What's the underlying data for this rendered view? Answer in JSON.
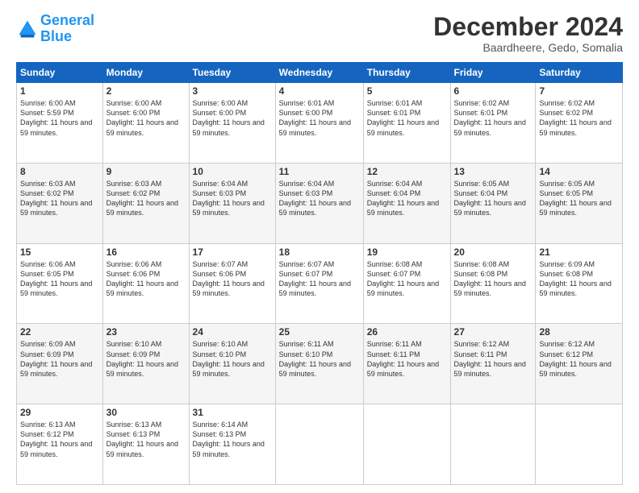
{
  "header": {
    "logo_line1": "General",
    "logo_line2": "Blue",
    "month": "December 2024",
    "location": "Baardheere, Gedo, Somalia"
  },
  "weekdays": [
    "Sunday",
    "Monday",
    "Tuesday",
    "Wednesday",
    "Thursday",
    "Friday",
    "Saturday"
  ],
  "weeks": [
    [
      {
        "day": "1",
        "sunrise": "6:00 AM",
        "sunset": "5:59 PM",
        "daylight": "11 hours and 59 minutes"
      },
      {
        "day": "2",
        "sunrise": "6:00 AM",
        "sunset": "6:00 PM",
        "daylight": "11 hours and 59 minutes"
      },
      {
        "day": "3",
        "sunrise": "6:00 AM",
        "sunset": "6:00 PM",
        "daylight": "11 hours and 59 minutes"
      },
      {
        "day": "4",
        "sunrise": "6:01 AM",
        "sunset": "6:00 PM",
        "daylight": "11 hours and 59 minutes"
      },
      {
        "day": "5",
        "sunrise": "6:01 AM",
        "sunset": "6:01 PM",
        "daylight": "11 hours and 59 minutes"
      },
      {
        "day": "6",
        "sunrise": "6:02 AM",
        "sunset": "6:01 PM",
        "daylight": "11 hours and 59 minutes"
      },
      {
        "day": "7",
        "sunrise": "6:02 AM",
        "sunset": "6:02 PM",
        "daylight": "11 hours and 59 minutes"
      }
    ],
    [
      {
        "day": "8",
        "sunrise": "6:03 AM",
        "sunset": "6:02 PM",
        "daylight": "11 hours and 59 minutes"
      },
      {
        "day": "9",
        "sunrise": "6:03 AM",
        "sunset": "6:02 PM",
        "daylight": "11 hours and 59 minutes"
      },
      {
        "day": "10",
        "sunrise": "6:04 AM",
        "sunset": "6:03 PM",
        "daylight": "11 hours and 59 minutes"
      },
      {
        "day": "11",
        "sunrise": "6:04 AM",
        "sunset": "6:03 PM",
        "daylight": "11 hours and 59 minutes"
      },
      {
        "day": "12",
        "sunrise": "6:04 AM",
        "sunset": "6:04 PM",
        "daylight": "11 hours and 59 minutes"
      },
      {
        "day": "13",
        "sunrise": "6:05 AM",
        "sunset": "6:04 PM",
        "daylight": "11 hours and 59 minutes"
      },
      {
        "day": "14",
        "sunrise": "6:05 AM",
        "sunset": "6:05 PM",
        "daylight": "11 hours and 59 minutes"
      }
    ],
    [
      {
        "day": "15",
        "sunrise": "6:06 AM",
        "sunset": "6:05 PM",
        "daylight": "11 hours and 59 minutes"
      },
      {
        "day": "16",
        "sunrise": "6:06 AM",
        "sunset": "6:06 PM",
        "daylight": "11 hours and 59 minutes"
      },
      {
        "day": "17",
        "sunrise": "6:07 AM",
        "sunset": "6:06 PM",
        "daylight": "11 hours and 59 minutes"
      },
      {
        "day": "18",
        "sunrise": "6:07 AM",
        "sunset": "6:07 PM",
        "daylight": "11 hours and 59 minutes"
      },
      {
        "day": "19",
        "sunrise": "6:08 AM",
        "sunset": "6:07 PM",
        "daylight": "11 hours and 59 minutes"
      },
      {
        "day": "20",
        "sunrise": "6:08 AM",
        "sunset": "6:08 PM",
        "daylight": "11 hours and 59 minutes"
      },
      {
        "day": "21",
        "sunrise": "6:09 AM",
        "sunset": "6:08 PM",
        "daylight": "11 hours and 59 minutes"
      }
    ],
    [
      {
        "day": "22",
        "sunrise": "6:09 AM",
        "sunset": "6:09 PM",
        "daylight": "11 hours and 59 minutes"
      },
      {
        "day": "23",
        "sunrise": "6:10 AM",
        "sunset": "6:09 PM",
        "daylight": "11 hours and 59 minutes"
      },
      {
        "day": "24",
        "sunrise": "6:10 AM",
        "sunset": "6:10 PM",
        "daylight": "11 hours and 59 minutes"
      },
      {
        "day": "25",
        "sunrise": "6:11 AM",
        "sunset": "6:10 PM",
        "daylight": "11 hours and 59 minutes"
      },
      {
        "day": "26",
        "sunrise": "6:11 AM",
        "sunset": "6:11 PM",
        "daylight": "11 hours and 59 minutes"
      },
      {
        "day": "27",
        "sunrise": "6:12 AM",
        "sunset": "6:11 PM",
        "daylight": "11 hours and 59 minutes"
      },
      {
        "day": "28",
        "sunrise": "6:12 AM",
        "sunset": "6:12 PM",
        "daylight": "11 hours and 59 minutes"
      }
    ],
    [
      {
        "day": "29",
        "sunrise": "6:13 AM",
        "sunset": "6:12 PM",
        "daylight": "11 hours and 59 minutes"
      },
      {
        "day": "30",
        "sunrise": "6:13 AM",
        "sunset": "6:13 PM",
        "daylight": "11 hours and 59 minutes"
      },
      {
        "day": "31",
        "sunrise": "6:14 AM",
        "sunset": "6:13 PM",
        "daylight": "11 hours and 59 minutes"
      },
      null,
      null,
      null,
      null
    ]
  ]
}
